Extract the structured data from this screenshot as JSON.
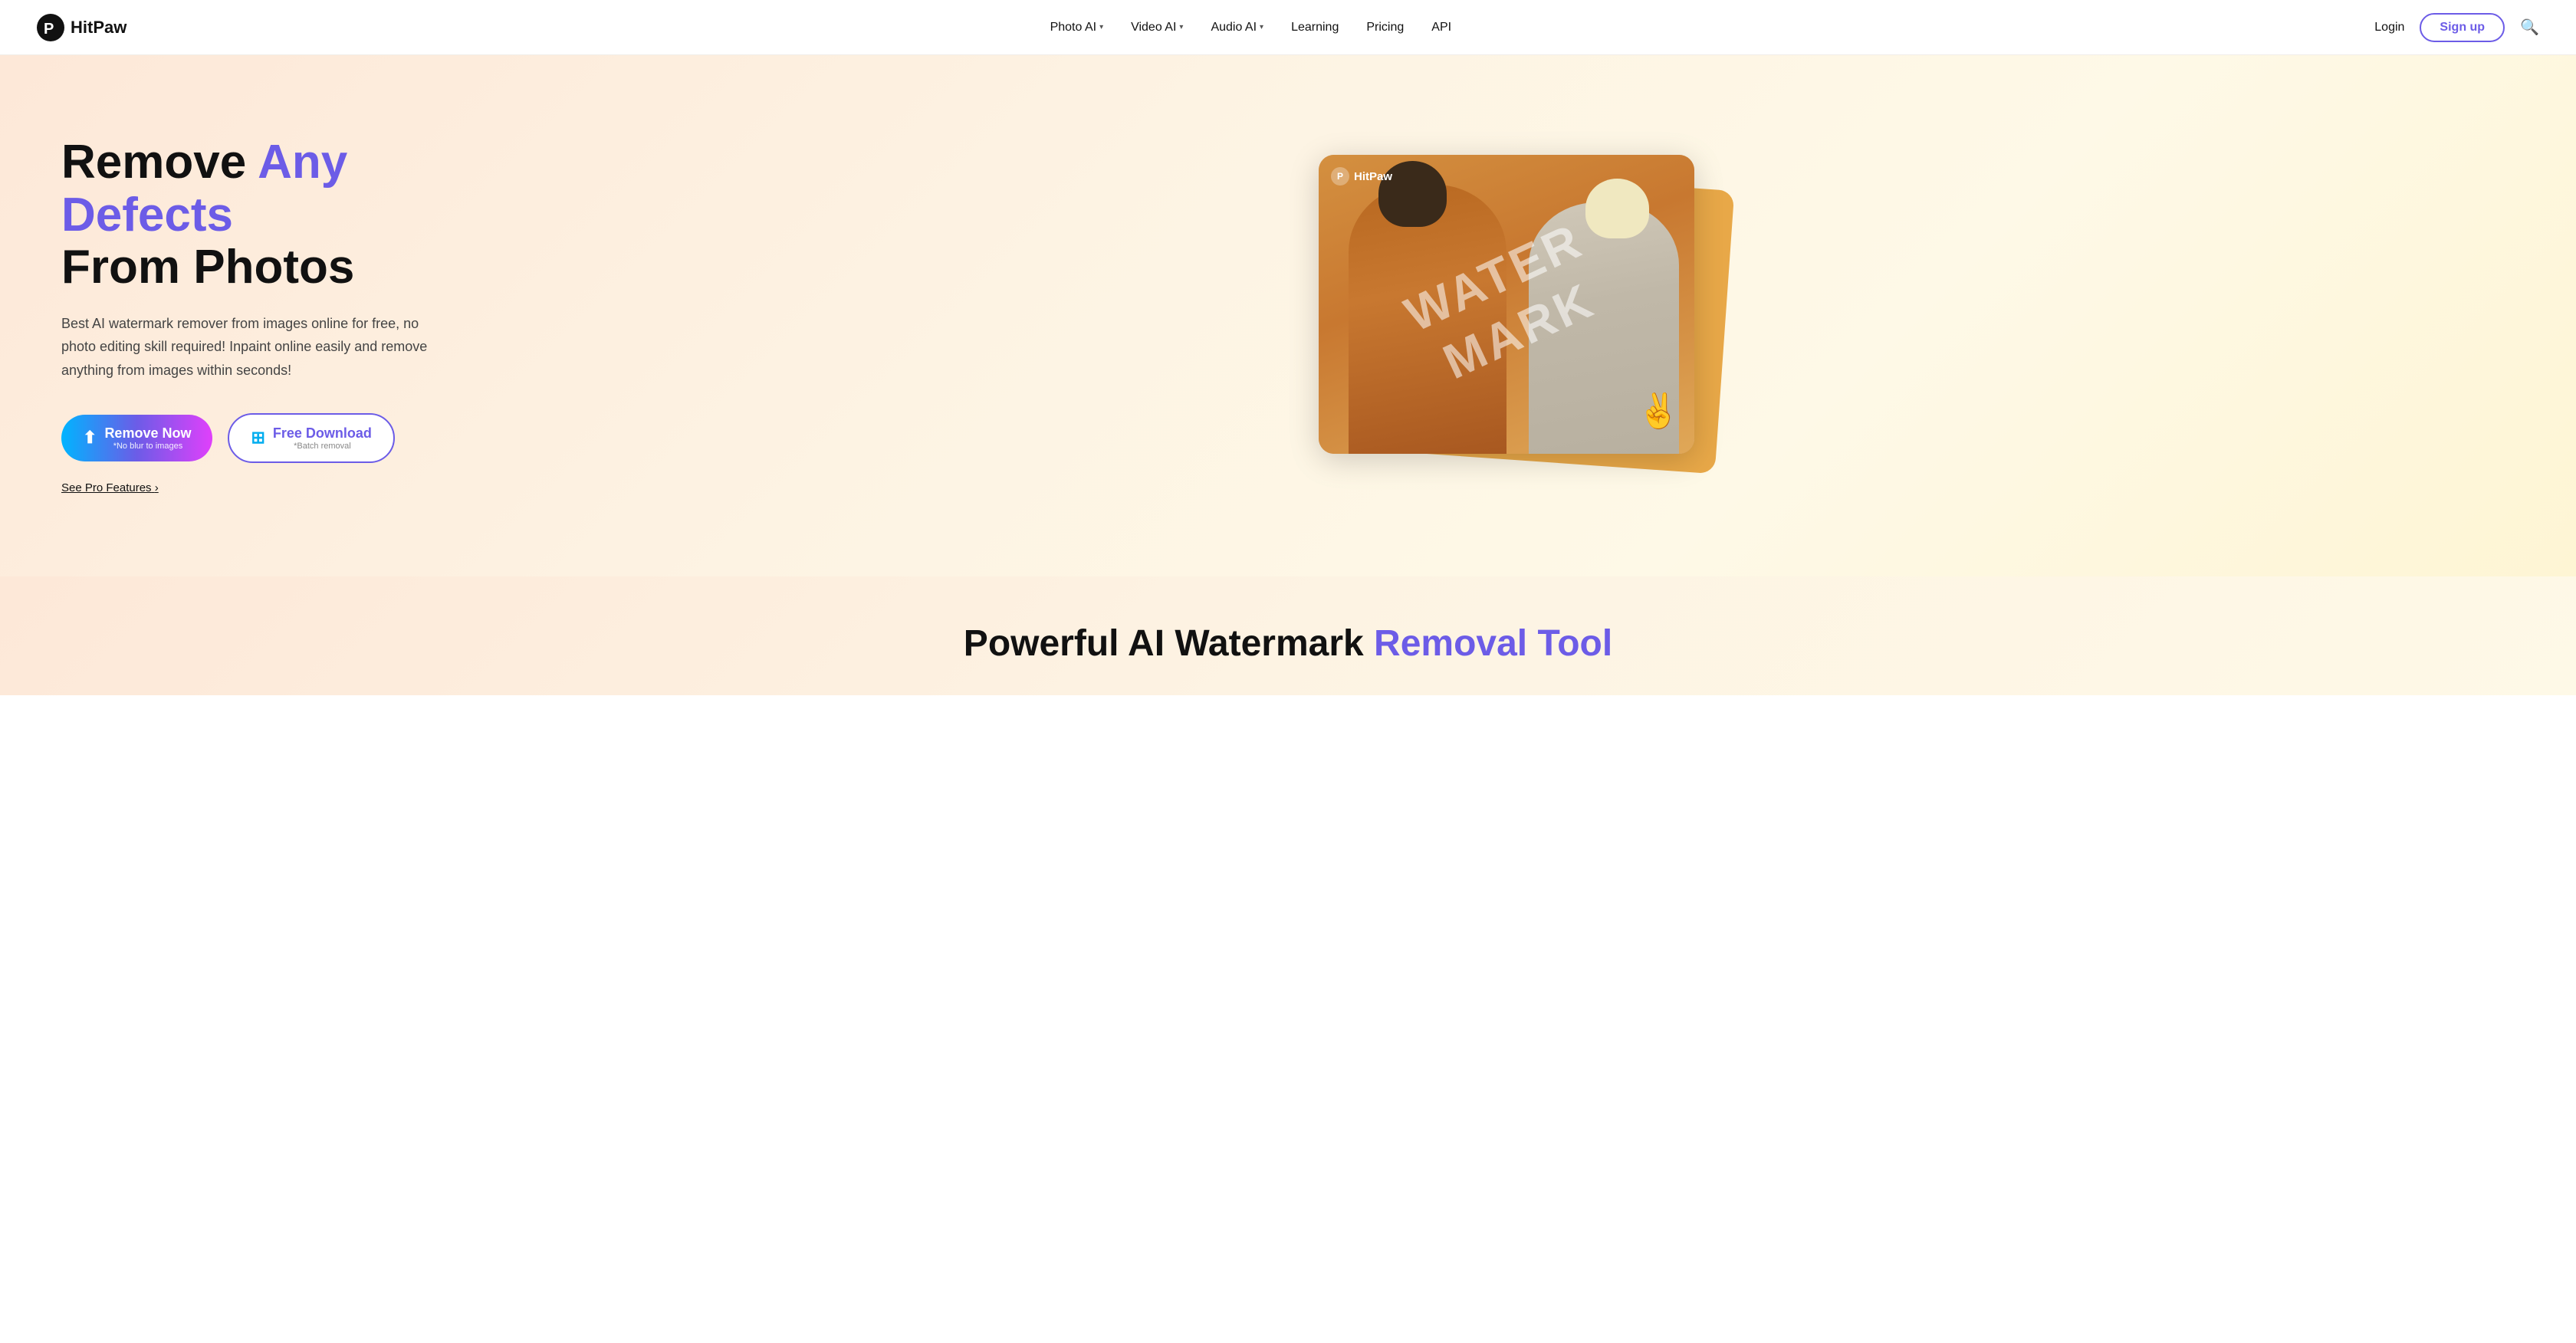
{
  "brand": {
    "name": "HitPaw",
    "logo_letter": "P"
  },
  "nav": {
    "links": [
      {
        "id": "photo-ai",
        "label": "Photo AI",
        "has_dropdown": true
      },
      {
        "id": "video-ai",
        "label": "Video AI",
        "has_dropdown": true
      },
      {
        "id": "audio-ai",
        "label": "Audio AI",
        "has_dropdown": true
      },
      {
        "id": "learning",
        "label": "Learning",
        "has_dropdown": false
      },
      {
        "id": "pricing",
        "label": "Pricing",
        "has_dropdown": false
      },
      {
        "id": "api",
        "label": "API",
        "has_dropdown": false
      }
    ],
    "login_label": "Login",
    "signup_label": "Sign up",
    "search_title": "Search"
  },
  "hero": {
    "title_line1": "Remove",
    "title_highlight": "Any Defects",
    "title_line2": "From Photos",
    "description": "Best AI watermark remover from images online for free, no photo editing skill required! Inpaint online easily and remove anything from images within seconds!",
    "btn_remove_now": "Remove Now",
    "btn_remove_sub": "*No blur to images",
    "btn_free_download": "Free Download",
    "btn_free_sub": "*Batch removal",
    "see_pro": "See Pro Features",
    "see_pro_arrow": "›",
    "hitpaw_overlay": "HitPaw",
    "watermark_text_1": "WATERMARK",
    "upload_icon": "⬆",
    "windows_icon": "⊞"
  },
  "bottom": {
    "title_part1": "Powerful AI Watermark Removal Tool"
  },
  "colors": {
    "accent": "#6c5ce7",
    "brand_gradient_start": "#00b4ff",
    "brand_gradient_end": "#e040fb",
    "hero_bg": "#fde8d8",
    "card_bg": "#e8a848"
  }
}
